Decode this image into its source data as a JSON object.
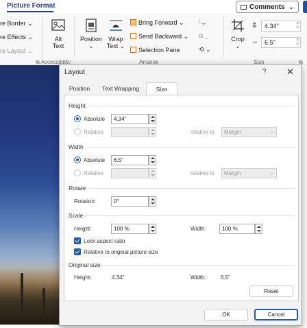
{
  "ribbon": {
    "active_tab": "Picture Format",
    "comments_label": "Comments",
    "picture_border": "re Border",
    "picture_effects": "re Effects",
    "picture_layout": "re Layout",
    "alt_text": [
      "Alt",
      "Text"
    ],
    "position": "Position",
    "wrap_text": [
      "Wrap",
      "Text"
    ],
    "bring_forward": "Bring Forward",
    "send_backward": "Send Backward",
    "selection_pane": "Selection Pane",
    "crop": "Crop",
    "height_value": "4.34\"",
    "width_value": "6.5\"",
    "group_accessibility": "Accessibility",
    "group_arrange": "Arrange",
    "group_size": "Size"
  },
  "dialog": {
    "title": "Layout",
    "help": "?",
    "close": "✕",
    "tabs": [
      "Position",
      "Text Wrapping",
      "Size"
    ],
    "active_tab": "Size",
    "height": {
      "section": "Height",
      "absolute_label": "Absolute",
      "absolute_value": "4.34\"",
      "relative_label": "Relative",
      "relative_to_label": "relative to",
      "relative_to_value": "Margin"
    },
    "width": {
      "section": "Width",
      "absolute_label": "Absolute",
      "absolute_value": "6.5\"",
      "relative_label": "Relative",
      "relative_to_label": "relative to",
      "relative_to_value": "Margin"
    },
    "rotate": {
      "section": "Rotate",
      "rotation_label": "Rotation:",
      "rotation_value": "0°"
    },
    "scale": {
      "section": "Scale",
      "height_label": "Height:",
      "height_value": "100 %",
      "width_label": "Width:",
      "width_value": "100 %",
      "lock_aspect": "Lock aspect ratio",
      "relative_original": "Relative to original picture size"
    },
    "original": {
      "section": "Original size",
      "height_label": "Height:",
      "height_value": "4.34\"",
      "width_label": "Width:",
      "width_value": "6.5\""
    },
    "reset_label": "Reset",
    "ok_label": "OK",
    "cancel_label": "Cancel"
  },
  "colors": {
    "accent": "#1e5bb8",
    "tab_text": "#2b3f8f"
  }
}
